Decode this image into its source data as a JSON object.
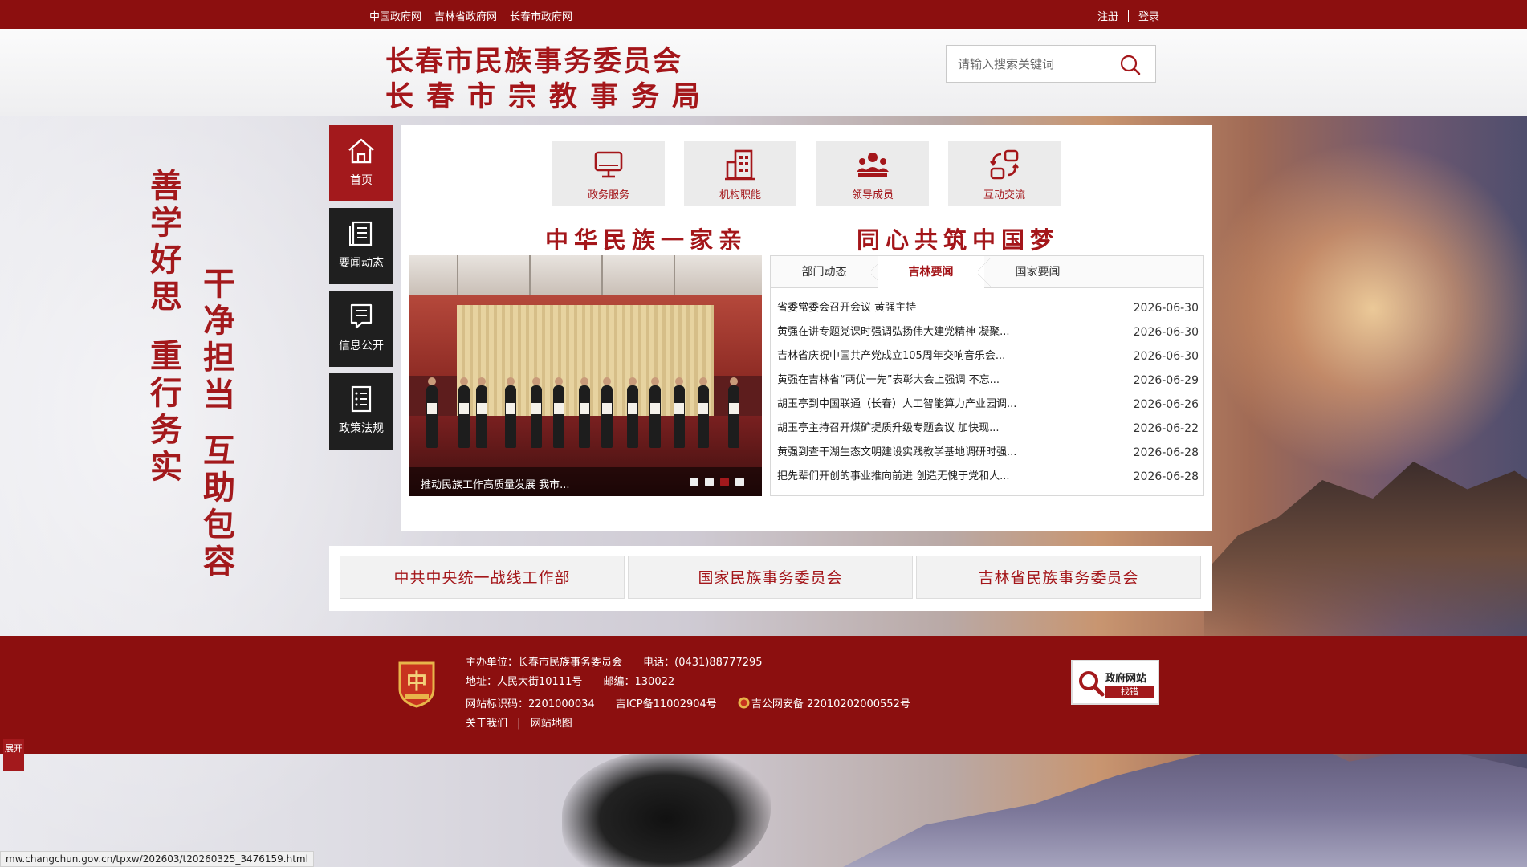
{
  "topbar": {
    "links": [
      "中国政府网",
      "吉林省政府网",
      "长春市政府网"
    ],
    "register": "注册",
    "login": "登录"
  },
  "header": {
    "title_line1": "长春市民族事务委员会",
    "title_line2": "长春市宗教事务局",
    "search_placeholder": "请输入搜索关键词"
  },
  "slogans": {
    "col1": "善学好思",
    "col2": "重行务实",
    "col3": "干净担当",
    "col4": "互助包容"
  },
  "left_nav": [
    {
      "label": "首页",
      "icon": "home-icon",
      "active": true
    },
    {
      "label": "要闻动态",
      "icon": "news-icon",
      "active": false
    },
    {
      "label": "信息公开",
      "icon": "info-icon",
      "active": false
    },
    {
      "label": "政策法规",
      "icon": "policy-icon",
      "active": false
    }
  ],
  "quick_buttons": [
    {
      "label": "政务服务",
      "icon": "monitor-icon"
    },
    {
      "label": "机构职能",
      "icon": "building-icon"
    },
    {
      "label": "领导成员",
      "icon": "people-icon"
    },
    {
      "label": "互动交流",
      "icon": "exchange-icon"
    }
  ],
  "banner": {
    "left": "中华民族一家亲",
    "right": "同心共筑中国梦"
  },
  "slider": {
    "caption": "推动民族工作高质量发展 我市...",
    "active_dot": 2,
    "dot_count": 4
  },
  "news": {
    "tabs": [
      "部门动态",
      "吉林要闻",
      "国家要闻"
    ],
    "active_tab": 1,
    "items": [
      {
        "title": "省委常委会召开会议 黄强主持",
        "date": "2026-06-30"
      },
      {
        "title": "黄强在讲专题党课时强调弘扬伟大建党精神 凝聚...",
        "date": "2026-06-30"
      },
      {
        "title": "吉林省庆祝中国共产党成立105周年交响音乐会...",
        "date": "2026-06-30"
      },
      {
        "title": "黄强在吉林省“两优一先”表彰大会上强调 不忘...",
        "date": "2026-06-29"
      },
      {
        "title": "胡玉亭到中国联通（长春）人工智能算力产业园调...",
        "date": "2026-06-26"
      },
      {
        "title": "胡玉亭主持召开煤矿提质升级专题会议 加快现...",
        "date": "2026-06-22"
      },
      {
        "title": "黄强到查干湖生态文明建设实践教学基地调研时强...",
        "date": "2026-06-28"
      },
      {
        "title": "把先辈们开创的事业推向前进 创造无愧于党和人...",
        "date": "2026-06-28"
      }
    ]
  },
  "links": [
    "中共中央统一战线工作部",
    "国家民族事务委员会",
    "吉林省民族事务委员会"
  ],
  "footer": {
    "host": "主办单位：长春市民族事务委员会",
    "phone": "电话：(0431)88777295",
    "address": "地址：人民大街10111号",
    "postcode": "邮编：130022",
    "site_id": "网站标识码：2201000034",
    "icp": "吉ICP备11002904号",
    "police": "吉公网安备 22010202000552号",
    "about": "关于我们",
    "sitemap": "网站地图",
    "find_error_line1": "政府网站",
    "find_error_line2": "找错"
  },
  "expand_label": "展开",
  "status_url": "mw.changchun.gov.cn/tpxw/202603/t20260325_3476159.html",
  "colors": {
    "brand_red": "#8c0f0f",
    "accent_red": "#a4161a",
    "nav_dark": "#1f1f1f"
  }
}
